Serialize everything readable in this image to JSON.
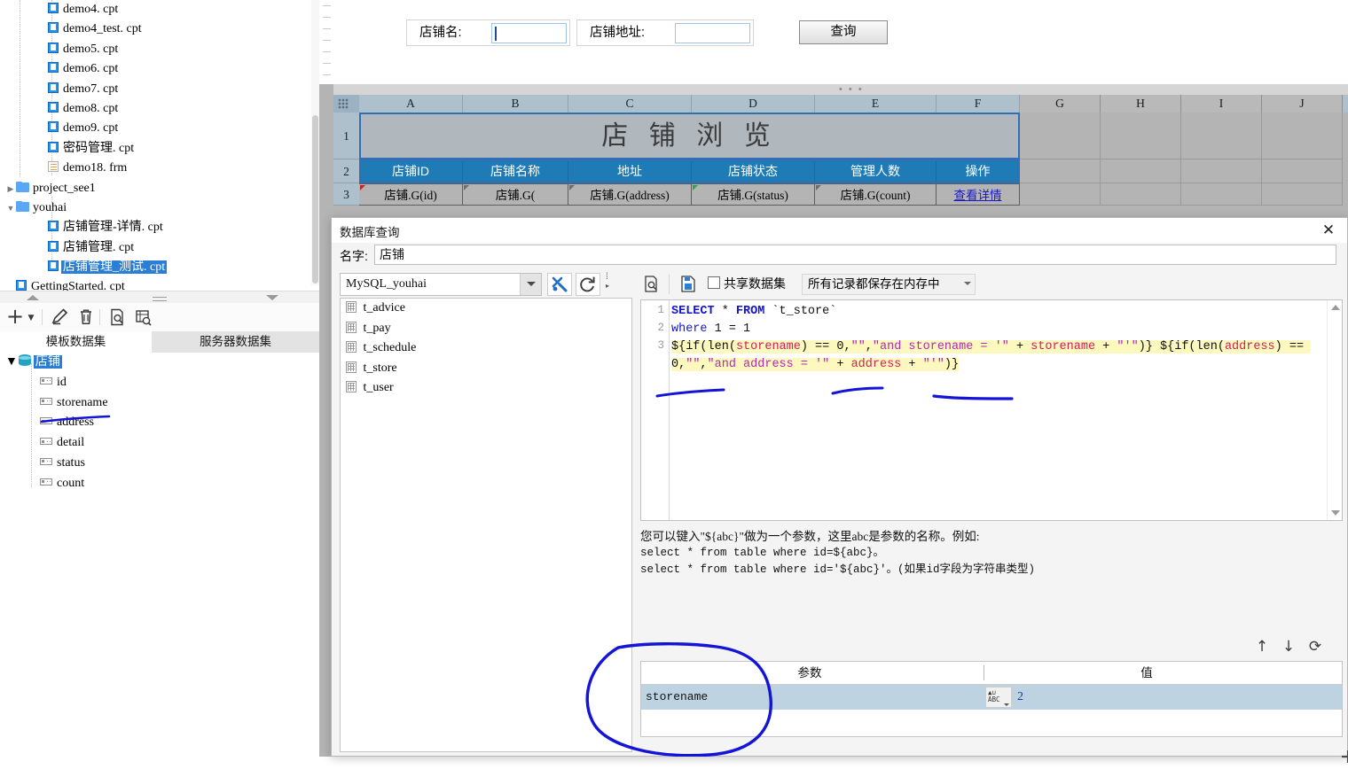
{
  "file_tree": {
    "items": [
      {
        "label": "demo4. cpt",
        "icon": "cpt-file-icon",
        "indent": 2,
        "twisty": "",
        "selected": false
      },
      {
        "label": "demo4_test. cpt",
        "icon": "cpt-file-icon",
        "indent": 2,
        "twisty": "",
        "selected": false
      },
      {
        "label": "demo5. cpt",
        "icon": "cpt-file-icon",
        "indent": 2,
        "twisty": "",
        "selected": false
      },
      {
        "label": "demo6. cpt",
        "icon": "cpt-file-icon",
        "indent": 2,
        "twisty": "",
        "selected": false
      },
      {
        "label": "demo7. cpt",
        "icon": "cpt-file-icon",
        "indent": 2,
        "twisty": "",
        "selected": false
      },
      {
        "label": "demo8. cpt",
        "icon": "cpt-file-icon",
        "indent": 2,
        "twisty": "",
        "selected": false
      },
      {
        "label": "demo9. cpt",
        "icon": "cpt-file-icon",
        "indent": 2,
        "twisty": "",
        "selected": false
      },
      {
        "label": "密码管理. cpt",
        "icon": "cpt-file-icon",
        "indent": 2,
        "twisty": "",
        "selected": false
      },
      {
        "label": "demo18. frm",
        "icon": "frm-file-icon",
        "indent": 2,
        "twisty": "",
        "selected": false
      },
      {
        "label": "project_see1",
        "icon": "folder-icon",
        "indent": 1,
        "twisty": "collapsed",
        "selected": false
      },
      {
        "label": "youhai",
        "icon": "folder-icon",
        "indent": 1,
        "twisty": "expanded",
        "selected": false
      },
      {
        "label": "店铺管理-详情. cpt",
        "icon": "cpt-file-icon",
        "indent": 2,
        "twisty": "",
        "selected": false
      },
      {
        "label": "店铺管理. cpt",
        "icon": "cpt-file-icon",
        "indent": 2,
        "twisty": "",
        "selected": false
      },
      {
        "label": "店铺管理_测试. cpt",
        "icon": "cpt-file-icon",
        "indent": 2,
        "twisty": "",
        "selected": true
      },
      {
        "label": "GettingStarted. cpt",
        "icon": "cpt-file-icon",
        "indent": 1,
        "twisty": "",
        "selected": false
      }
    ]
  },
  "dataset_toolbar": {
    "buttons": [
      {
        "name": "add-dataset-button",
        "glyph": "+"
      },
      {
        "name": "add-dataset-dropdown-arrow",
        "glyph": "▾"
      },
      {
        "name": "edit-dataset-button",
        "glyph": "✎"
      },
      {
        "name": "delete-dataset-button",
        "glyph": "🗑"
      },
      {
        "name": "preview-dataset-button",
        "glyph": "🔍"
      },
      {
        "name": "dataset-search-button",
        "glyph": "▤"
      }
    ]
  },
  "dataset_tabs": {
    "template_tab": "模板数据集",
    "server_tab": "服务器数据集"
  },
  "dataset_tree": {
    "root": "店铺",
    "fields": [
      "id",
      "storename",
      "address",
      "detail",
      "status",
      "count"
    ]
  },
  "report": {
    "form": {
      "store_name_label": "店铺名:",
      "store_name_value": "",
      "address_label": "店铺地址:",
      "address_value": "",
      "query_button": "查询"
    },
    "grid": {
      "columns": [
        "A",
        "B",
        "C",
        "D",
        "E",
        "F",
        "G",
        "H",
        "I",
        "J"
      ],
      "row_numbers": [
        "1",
        "2",
        "3"
      ],
      "title_cell": "店 铺 浏 览",
      "header_row": [
        "店铺ID",
        "店铺名称",
        "地址",
        "店铺状态",
        "管理人数",
        "操作"
      ],
      "data_row": [
        "店铺.G(id)",
        "店铺.G(",
        "店铺.G(address)",
        "店铺.G(status)",
        "店铺.G(count)",
        "查看详情"
      ]
    }
  },
  "dialog": {
    "title": "数据库查询",
    "close_icon": "✕",
    "name_label": "名字:",
    "name_value": "店铺",
    "connection": "MySQL_youhai",
    "tool_buttons": [
      {
        "name": "database-config-button",
        "glyph": "✂"
      },
      {
        "name": "refresh-connection-button",
        "glyph": "⟳"
      }
    ],
    "tables": [
      "t_advice",
      "t_pay",
      "t_schedule",
      "t_store",
      "t_user"
    ],
    "sql_toolbar": {
      "preview_icon": "🔍",
      "save_icon": "▣",
      "share_checkbox_label": "共享数据集",
      "share_checked": false,
      "memory_option": "所有记录都保存在内存中"
    },
    "sql": {
      "line_numbers": [
        "1",
        "2",
        "3"
      ],
      "line1": "SELECT * FROM `t_store`",
      "line2": "where 1 = 1",
      "line3": "${if(len(storename) == 0,\"\",\"and storename = '\" + storename + \"'\")} ${if(len(address) == 0,\"\",\"and address = '\" + address + \"'\")}"
    },
    "help": {
      "line1": "您可以键入\"${abc}\"做为一个参数，这里abc是参数的名称。例如:",
      "line2": "select * from table where id=${abc}。",
      "line3": "select * from table where id='${abc}'。(如果id字段为字符串类型)"
    },
    "param_tools": [
      {
        "name": "move-param-up-button",
        "glyph": "↑"
      },
      {
        "name": "move-param-down-button",
        "glyph": "↓"
      },
      {
        "name": "refresh-params-button",
        "glyph": "⟳"
      }
    ],
    "param_table": {
      "col_param": "参数",
      "col_value": "值",
      "rows": [
        {
          "name": "storename",
          "type_icon": "ABC",
          "value": "2"
        }
      ]
    }
  },
  "colors": {
    "selection_blue": "#2a7fd4",
    "header_blue": "#1f7bb6",
    "annotation_blue": "#1414d8",
    "sql_highlight": "#fdf8bd"
  }
}
